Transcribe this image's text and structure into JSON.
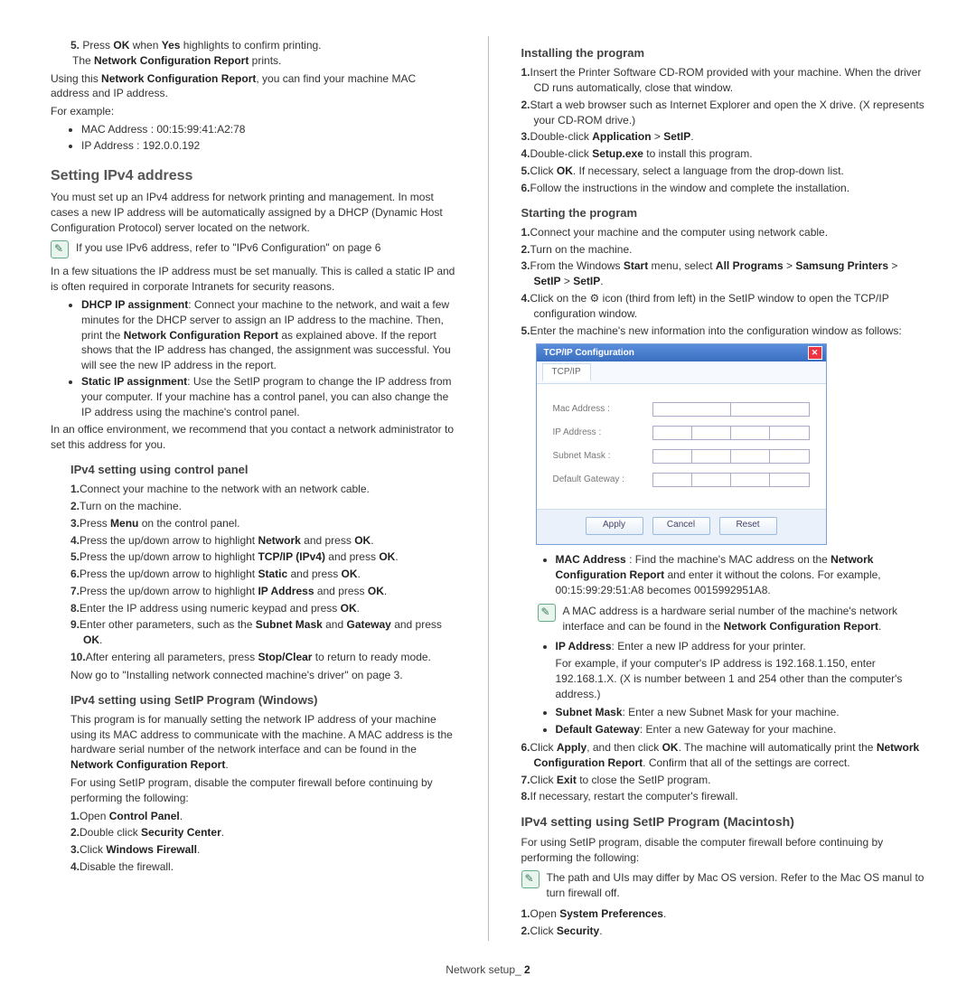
{
  "left": {
    "ol5": {
      "n": "5.",
      "t1": "Press ",
      "b1": "OK",
      "t2": " when ",
      "b2": "Yes",
      "t3": " highlights to confirm printing.",
      "sub1": "The ",
      "sub1b": "Network Configuration Report",
      "sub1c": " prints."
    },
    "p1a": "Using this ",
    "p1b": "Network Configuration Report",
    "p1c": ", you can find your machine MAC address and IP address.",
    "p2": "For example:",
    "li_mac": "MAC Address : 00:15:99:41:A2:78",
    "li_ip": "IP Address : 192.0.0.192",
    "h2": "Setting IPv4 address",
    "p3": "You must set up an IPv4 address for network printing and management. In most cases a new IP address will be automatically assigned by a DHCP (Dynamic Host Configuration Protocol) server located on the network.",
    "note1": "If you use IPv6 address, refer to \"IPv6 Configuration\" on page 6",
    "p4": "In a few situations the IP address must be set manually. This is called a static IP and is often required in corporate Intranets for security reasons.",
    "dhcp_b": "DHCP IP assignment",
    "dhcp_t1": ": Connect your machine to the network, and wait a few minutes for the DHCP server to assign an IP address to the machine. Then, print the ",
    "dhcp_b2": "Network Configuration Report",
    "dhcp_t2": " as explained above. If the report shows that the IP address has changed, the assignment was successful. You will see the new IP address in the report.",
    "static_b": "Static IP assignment",
    "static_t": ": Use the SetIP program to change the IP address from your computer. If your machine has a control panel, you can also change the IP address using the machine's control panel.",
    "p5": "In an office environment, we recommend that you contact a network administrator to set this address for you.",
    "h3a": "IPv4 setting using control panel",
    "cp": {
      "i1a": "Connect your machine to the network with an network cable.",
      "i2a": "Turn on the machine.",
      "i3a": "Press ",
      "i3b": "Menu",
      "i3c": " on the control panel.",
      "i4a": "Press the up/down arrow to highlight ",
      "i4b": "Network",
      "i4c": " and press ",
      "i4d": "OK",
      "i4e": ".",
      "i5a": "Press the up/down arrow to highlight ",
      "i5b": "TCP/IP (IPv4)",
      "i5c": " and press ",
      "i5d": "OK",
      "i5e": ".",
      "i6a": "Press the up/down arrow to highlight ",
      "i6b": "Static",
      "i6c": " and press ",
      "i6d": "OK",
      "i6e": ".",
      "i7a": "Press the up/down arrow to highlight ",
      "i7b": "IP Address",
      "i7c": " and press ",
      "i7d": "OK",
      "i7e": ".",
      "i8a": "Enter the IP address using numeric keypad and press ",
      "i8b": "OK",
      "i8c": ".",
      "i9a": "Enter other parameters, such as the ",
      "i9b": "Subnet Mask",
      "i9c": " and ",
      "i9d": "Gateway",
      "i9e": " and press ",
      "i9f": "OK",
      "i9g": ".",
      "i10a": "After entering all parameters, press ",
      "i10b": "Stop/Clear",
      "i10c": " to return to ready mode."
    },
    "p6": "Now go to \"Installing network connected machine's driver\" on page 3.",
    "h3b": "IPv4 setting using SetIP Program (Windows)",
    "p7a": "This program is for manually setting the network IP address of your machine using its MAC address to communicate with the machine. A MAC address is the hardware serial number of the network interface and can be found in the ",
    "p7b": "Network Configuration Report",
    "p7c": ".",
    "p8": "For using SetIP program, disable the computer firewall before continuing by performing the following:",
    "fw": {
      "i1a": "Open ",
      "i1b": "Control Panel",
      "i1c": ".",
      "i2a": "Double click ",
      "i2b": "Security Center",
      "i2c": ".",
      "i3a": "Click ",
      "i3b": "Windows Firewall",
      "i3c": ".",
      "i4a": "Disable the firewall."
    }
  },
  "right": {
    "h3a": "Installing the program",
    "inst": {
      "i1": "Insert the Printer Software CD-ROM provided with your machine. When the driver CD runs automatically, close that window.",
      "i2": "Start a web browser such as Internet Explorer and open the X drive. (X represents your CD-ROM drive.)",
      "i3a": "Double-click ",
      "i3b": "Application",
      "i3c": " > ",
      "i3d": "SetIP",
      "i3e": ".",
      "i4a": "Double-click ",
      "i4b": "Setup.exe",
      "i4c": " to install this program.",
      "i5a": "Click ",
      "i5b": "OK",
      "i5c": ". If necessary, select a language from the drop-down list.",
      "i6": "Follow the instructions in the window and complete the installation."
    },
    "h3b": "Starting the program",
    "start": {
      "i1": "Connect your machine and the computer using network cable.",
      "i2": "Turn on the machine.",
      "i3a": "From the Windows ",
      "i3b": "Start",
      "i3c": " menu, select ",
      "i3d": "All Programs",
      "i3e": " > ",
      "i3f": "Samsung Printers",
      "i3g": " > ",
      "i3h": "SetIP",
      "i3i": " > ",
      "i3j": "SetIP",
      "i3k": ".",
      "i4a": "Click on the ",
      "i4b": " icon (third from left) in the SetIP window to open the TCP/IP configuration window.",
      "i5": "Enter the machine's new information into the configuration window as follows:"
    },
    "dlg": {
      "title": "TCP/IP Configuration",
      "tab": "TCP/IP",
      "mac": "Mac Address :",
      "ip": "IP Address :",
      "sn": "Subnet Mask :",
      "gw": "Default Gateway :",
      "apply": "Apply",
      "cancel": "Cancel",
      "reset": "Reset"
    },
    "bl": {
      "mac_b": "MAC Address",
      "mac_t1": " : Find the machine's MAC address on the ",
      "mac_b2": "Network Configuration Report",
      "mac_t2": " and enter it without the colons. For example, 00:15:99:29:51:A8 becomes 0015992951A8.",
      "note": "A MAC address is a hardware serial number of the machine's network interface and can be found in the ",
      "note_b": "Network Configuration Report",
      "note_c": ".",
      "ip_b": "IP Address",
      "ip_t": ": Enter a new IP address for your printer.",
      "ip_ex": "For example, if your computer's IP address is 192.168.1.150, enter 192.168.1.X. (X is number between 1 and 254 other than the computer's address.)",
      "sn_b": "Subnet Mask",
      "sn_t": ": Enter a new Subnet Mask for your machine.",
      "gw_b": "Default Gateway",
      "gw_t": ": Enter a new Gateway for your machine."
    },
    "s6a": "Click ",
    "s6b": "Apply",
    "s6c": ", and then click ",
    "s6d": "OK",
    "s6e": ". The machine will automatically print the ",
    "s6f": "Network Configuration Report",
    "s6g": ". Confirm that all of the settings are correct.",
    "s7a": "Click ",
    "s7b": "Exit",
    "s7c": " to close the SetIP program.",
    "s8": "If necessary, restart the computer's firewall.",
    "h3c": "IPv4 setting using SetIP Program (Macintosh)",
    "pmac": "For using SetIP program, disable the computer firewall before continuing by performing the following:",
    "notemac": "The path and UIs may differ by Mac OS version. Refer to the Mac OS manul to turn firewall off.",
    "mac1a": "Open ",
    "mac1b": "System Preferences",
    "mac1c": ".",
    "mac2a": "Click ",
    "mac2b": "Security",
    "mac2c": "."
  },
  "footer": {
    "label": "Network setup_ ",
    "page": "2"
  }
}
